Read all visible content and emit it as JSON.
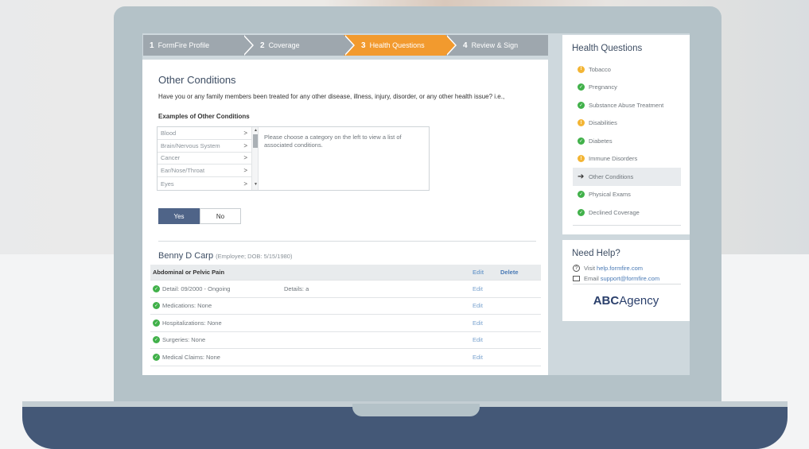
{
  "steps": [
    {
      "num": "1",
      "label": "FormFire Profile"
    },
    {
      "num": "2",
      "label": "Coverage"
    },
    {
      "num": "3",
      "label": "Health Questions"
    },
    {
      "num": "4",
      "label": "Review & Sign"
    }
  ],
  "main": {
    "title": "Other Conditions",
    "question": "Have you or any family members been treated for any other disease, illness, injury, disorder, or any other health issue? i.e.,",
    "examples_label": "Examples of Other Conditions",
    "categories": [
      "Blood",
      "Brain/Nervous System",
      "Cancer",
      "Ear/Nose/Throat",
      "Eyes"
    ],
    "category_hint": "Please choose a category on the left to view a list of associated conditions.",
    "yes_label": "Yes",
    "no_label": "No"
  },
  "person": {
    "name": "Benny D Carp",
    "detail": "(Employee; DOB: 5/15/1980)"
  },
  "table": {
    "header": "Abdominal or Pelvic Pain",
    "edit_label": "Edit",
    "delete_label": "Delete",
    "rows": [
      {
        "label": "Detail: 09/2000 - Ongoing",
        "details": "Details: a",
        "edit": "Edit"
      },
      {
        "label": "Medications: None",
        "details": "",
        "edit": "Edit"
      },
      {
        "label": "Hospitalizations: None",
        "details": "",
        "edit": "Edit"
      },
      {
        "label": "Surgeries: None",
        "details": "",
        "edit": "Edit"
      },
      {
        "label": "Medical Claims: None",
        "details": "",
        "edit": "Edit"
      }
    ]
  },
  "side": {
    "title": "Health Questions",
    "items": [
      {
        "label": "Tobacco",
        "status": "warning"
      },
      {
        "label": "Pregnancy",
        "status": "complete"
      },
      {
        "label": "Substance Abuse Treatment",
        "status": "complete"
      },
      {
        "label": "Disabilities",
        "status": "warning"
      },
      {
        "label": "Diabetes",
        "status": "complete"
      },
      {
        "label": "Immune Disorders",
        "status": "warning"
      },
      {
        "label": "Other Conditions",
        "status": "current"
      },
      {
        "label": "Physical Exams",
        "status": "complete"
      },
      {
        "label": "Declined Coverage",
        "status": "complete"
      }
    ]
  },
  "help": {
    "title": "Need Help?",
    "visit_prefix": "Visit",
    "visit_link": "help.formfire.com",
    "email_prefix": "Email",
    "email_link": "support@formfire.com",
    "logo_bold": "ABC",
    "logo_rest": "Agency"
  },
  "colors": {
    "accent": "#f29a2e",
    "step_inactive": "#9ea7ae",
    "primary_button": "#4f6488",
    "complete": "#41b14a",
    "warning": "#f3b534",
    "link": "#4a7ab5"
  }
}
